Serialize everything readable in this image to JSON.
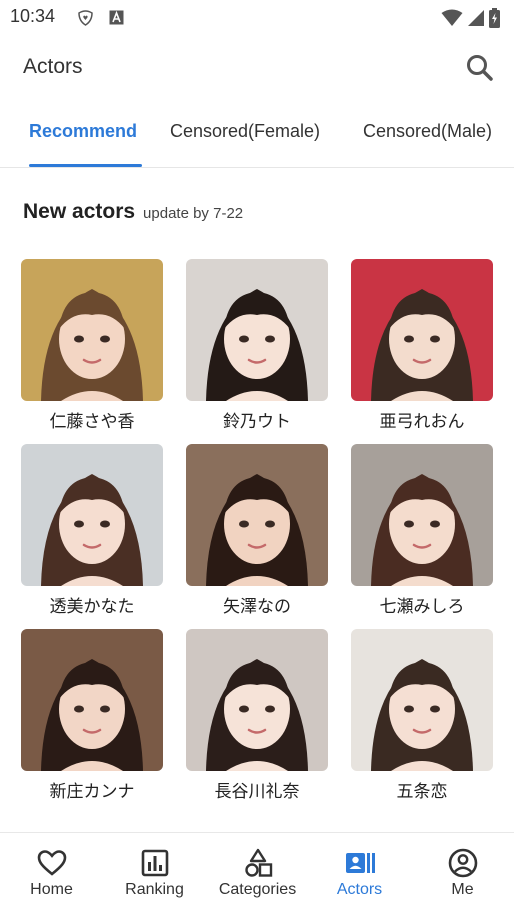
{
  "status_bar": {
    "time": "10:34",
    "icons": [
      "notification-app-icon",
      "a-badge-icon",
      "wifi-icon",
      "signal-icon",
      "battery-icon"
    ]
  },
  "app_bar": {
    "title": "Actors",
    "search_icon": "search-icon"
  },
  "tabs": [
    {
      "label": "Recommend",
      "active": true
    },
    {
      "label": "Censored(Female)",
      "active": false
    },
    {
      "label": "Censored(Male)",
      "active": false
    }
  ],
  "section": {
    "title": "New actors",
    "subtitle": "update by 7-22"
  },
  "actors": [
    {
      "name": "仁藤さや香",
      "bg": "#c7a45a",
      "hair": "#6b4a2f",
      "skin": "#f3d6c4"
    },
    {
      "name": "鈴乃ウト",
      "bg": "#d9d4d0",
      "hair": "#241a16",
      "skin": "#f6e2d6"
    },
    {
      "name": "亜弓れおん",
      "bg": "#c93444",
      "hair": "#3b2a22",
      "skin": "#f3dccd"
    },
    {
      "name": "透美かなた",
      "bg": "#cfd3d6",
      "hair": "#4a2f24",
      "skin": "#f5ddd0"
    },
    {
      "name": "矢澤なの",
      "bg": "#8a6f5c",
      "hair": "#2a1a14",
      "skin": "#f1d3c1"
    },
    {
      "name": "七瀬みしろ",
      "bg": "#a7a09a",
      "hair": "#4a2c22",
      "skin": "#f4dccd"
    },
    {
      "name": "新庄カンナ",
      "bg": "#7a5a46",
      "hair": "#2a1b16",
      "skin": "#f2d6c6"
    },
    {
      "name": "長谷川礼奈",
      "bg": "#cfc7c2",
      "hair": "#2b1e1a",
      "skin": "#f6e3d8"
    },
    {
      "name": "五条恋",
      "bg": "#e7e3de",
      "hair": "#3a2a22",
      "skin": "#f5dfd3"
    }
  ],
  "bottom_nav": [
    {
      "label": "Home",
      "icon": "heart-icon",
      "active": false
    },
    {
      "label": "Ranking",
      "icon": "bar-chart-icon",
      "active": false
    },
    {
      "label": "Categories",
      "icon": "shapes-icon",
      "active": false
    },
    {
      "label": "Actors",
      "icon": "id-card-icon",
      "active": true
    },
    {
      "label": "Me",
      "icon": "account-circle-icon",
      "active": false
    }
  ],
  "colors": {
    "accent": "#2d7ad8",
    "text": "#222222",
    "divider": "#e6e6e6"
  }
}
